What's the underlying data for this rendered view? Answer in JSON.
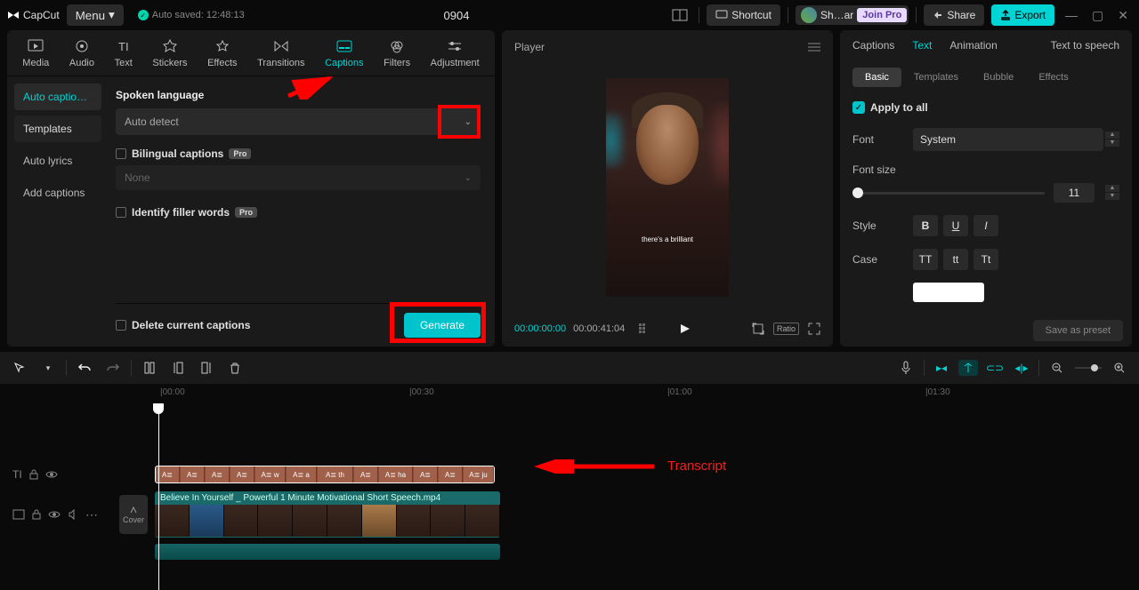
{
  "app": {
    "name": "CapCut",
    "menu": "Menu",
    "autosave": "Auto saved: 12:48:13",
    "project": "0904"
  },
  "topbar": {
    "shortcut": "Shortcut",
    "user": "Sh…ar",
    "join_pro": "Join Pro",
    "share": "Share",
    "export": "Export"
  },
  "tools": [
    "Media",
    "Audio",
    "Text",
    "Stickers",
    "Effects",
    "Transitions",
    "Captions",
    "Filters",
    "Adjustment"
  ],
  "captions_side": [
    "Auto captio…",
    "Templates",
    "Auto lyrics",
    "Add captions"
  ],
  "captions_panel": {
    "lang_label": "Spoken language",
    "lang_value": "Auto detect",
    "bilingual": "Bilingual captions",
    "none": "None",
    "filler": "Identify filler words",
    "delete": "Delete current captions",
    "generate": "Generate",
    "pro": "Pro"
  },
  "player": {
    "title": "Player",
    "caption": "there's a brilliant",
    "time_cur": "00:00:00:00",
    "time_dur": "00:00:41:04",
    "ratio": "Ratio"
  },
  "right": {
    "tabs": [
      "Captions",
      "Text",
      "Animation",
      "Text to speech"
    ],
    "subtabs": [
      "Basic",
      "Templates",
      "Bubble",
      "Effects"
    ],
    "apply_all": "Apply to all",
    "font_label": "Font",
    "font_value": "System",
    "size_label": "Font size",
    "size_value": "11",
    "style_label": "Style",
    "bold": "B",
    "underline": "U",
    "italic": "I",
    "case_label": "Case",
    "case_tt": "TT",
    "case_tt2": "tt",
    "case_tt3": "Tt",
    "save_preset": "Save as preset"
  },
  "ruler": [
    "00:00",
    "00:30",
    "01:00",
    "01:30"
  ],
  "clip": {
    "name": "Believe In Yourself _ Powerful 1 Minute Motivational Short Speech.mp4"
  },
  "caption_clips": [
    "A≣",
    "A≣",
    "A≣",
    "A≣",
    "A≣ w",
    "A≣ a",
    "A≣ th",
    "A≣",
    "A≣ ha",
    "A≣",
    "A≣",
    "A≣ ju"
  ],
  "annot": {
    "transcript": "Transcript"
  },
  "cover": "Cover"
}
